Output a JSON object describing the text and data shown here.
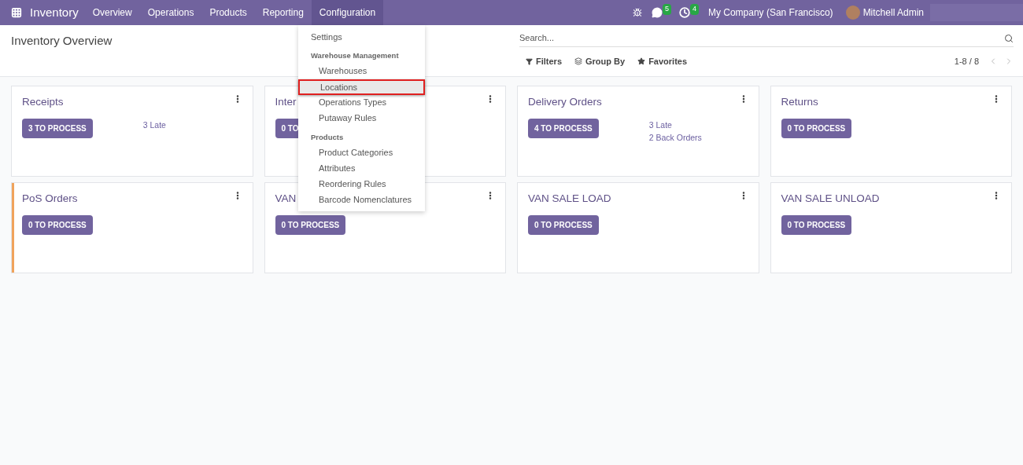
{
  "navbar": {
    "app": "Inventory",
    "menus": [
      {
        "label": "Overview",
        "selected": false
      },
      {
        "label": "Operations",
        "selected": false
      },
      {
        "label": "Products",
        "selected": false
      },
      {
        "label": "Reporting",
        "selected": false
      },
      {
        "label": "Configuration",
        "selected": true
      }
    ],
    "messages_count": "5",
    "activities_count": "4",
    "company": "My Company (San Francisco)",
    "user": "Mitchell Admin"
  },
  "dropdown": [
    {
      "kind": "item",
      "label": "Settings",
      "selected": false
    },
    {
      "kind": "header",
      "label": "Warehouse Management"
    },
    {
      "kind": "subitem",
      "label": "Warehouses",
      "selected": false
    },
    {
      "kind": "subitem",
      "label": "Locations",
      "selected": true
    },
    {
      "kind": "subitem",
      "label": "Operations Types",
      "selected": false
    },
    {
      "kind": "subitem",
      "label": "Putaway Rules",
      "selected": false
    },
    {
      "kind": "header",
      "label": "Products"
    },
    {
      "kind": "subitem",
      "label": "Product Categories",
      "selected": false
    },
    {
      "kind": "subitem",
      "label": "Attributes",
      "selected": false
    },
    {
      "kind": "subitem",
      "label": "Reordering Rules",
      "selected": false
    },
    {
      "kind": "subitem",
      "label": "Barcode Nomenclatures",
      "selected": false
    }
  ],
  "control_panel": {
    "title": "Inventory Overview",
    "search_placeholder": "Search...",
    "filters": "Filters",
    "group_by": "Group By",
    "favorites": "Favorites",
    "pager": "1-8 / 8"
  },
  "cards": [
    {
      "title": "Receipts",
      "button": "3 TO PROCESS",
      "links": [
        "3 Late"
      ]
    },
    {
      "title": "Inter",
      "button": "0 TO"
    },
    {
      "title": "Delivery Orders",
      "button": "4 TO PROCESS",
      "links": [
        "3 Late",
        "2 Back Orders"
      ]
    },
    {
      "title": "Returns",
      "button": "0 TO PROCESS"
    },
    {
      "title": "PoS Orders",
      "button": "0 TO PROCESS",
      "color": "#f0a35c"
    },
    {
      "title": "VAN",
      "button": "0 TO PROCESS"
    },
    {
      "title": "VAN SALE LOAD",
      "button": "0 TO PROCESS"
    },
    {
      "title": "VAN SALE UNLOAD",
      "button": "0 TO PROCESS"
    }
  ]
}
